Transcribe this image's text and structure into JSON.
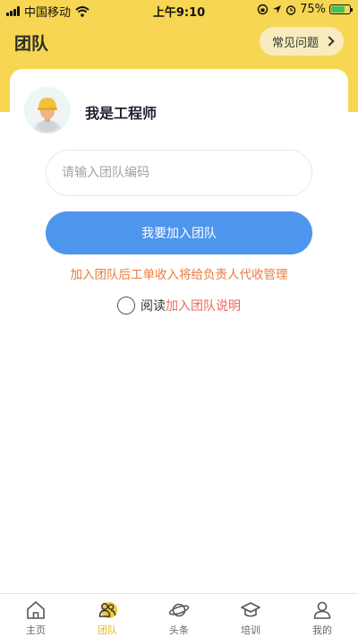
{
  "status_bar": {
    "carrier": "中国移动",
    "time": "上午9:10",
    "battery_percent": "75%",
    "battery_level": 0.75,
    "battery_color": "#3fc25b"
  },
  "header": {
    "title": "团队",
    "faq_label": "常见问题",
    "background_color": "#f6d652"
  },
  "profile": {
    "name": "我是工程师",
    "avatar_icon": "worker-avatar-icon"
  },
  "team_form": {
    "input_placeholder": "请输入团队编码",
    "input_value": "",
    "join_button_label": "我要加入团队",
    "join_button_color": "#4e95ee",
    "notice": "加入团队后工单收入将给负责人代收管理",
    "notice_color": "#ec7a3c",
    "agree_prefix": "阅读",
    "agree_link": "加入团队说明",
    "agree_checked": false
  },
  "tab_bar": {
    "active_color": "#e7b62e",
    "items": [
      {
        "label": "主页",
        "icon": "home-icon",
        "active": false
      },
      {
        "label": "团队",
        "icon": "team-icon",
        "active": true
      },
      {
        "label": "头条",
        "icon": "planet-icon",
        "active": false
      },
      {
        "label": "培训",
        "icon": "graduation-cap-icon",
        "active": false
      },
      {
        "label": "我的",
        "icon": "person-icon",
        "active": false
      }
    ]
  }
}
